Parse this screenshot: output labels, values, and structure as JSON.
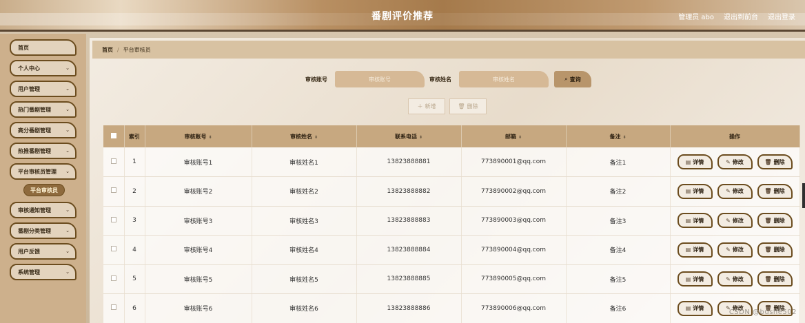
{
  "header": {
    "title": "番剧评价推荐",
    "user": "管理员 abo",
    "back_front": "退出到前台",
    "logout": "退出登录"
  },
  "sidebar": {
    "items": [
      {
        "label": "首页",
        "chevron": false
      },
      {
        "label": "个人中心",
        "chevron": true
      },
      {
        "label": "用户管理",
        "chevron": true
      },
      {
        "label": "热门番剧管理",
        "chevron": true
      },
      {
        "label": "高分番剧管理",
        "chevron": true
      },
      {
        "label": "热推番剧管理",
        "chevron": true
      },
      {
        "label": "平台审核员管理",
        "chevron": true
      },
      {
        "label": "审核通知管理",
        "chevron": true
      },
      {
        "label": "番剧分类管理",
        "chevron": true
      },
      {
        "label": "用户反馈",
        "chevron": true
      },
      {
        "label": "系统管理",
        "chevron": true
      }
    ],
    "active_sub": "平台审核员"
  },
  "breadcrumb": {
    "home": "首页",
    "sep": "/",
    "current": "平台审核员"
  },
  "search": {
    "account_label": "审核账号",
    "account_placeholder": "审核账号",
    "name_label": "审核姓名",
    "name_placeholder": "审核姓名",
    "query_label": "查询"
  },
  "actions": {
    "add": "新增",
    "delete": "删除"
  },
  "table": {
    "headers": {
      "index": "索引",
      "account": "审核账号",
      "name": "审核姓名",
      "phone": "联系电话",
      "email": "邮箱",
      "note": "备注",
      "ops": "操作"
    },
    "rows": [
      {
        "index": "1",
        "account": "审核账号1",
        "name": "审核姓名1",
        "phone": "13823888881",
        "email": "773890001@qq.com",
        "note": "备注1"
      },
      {
        "index": "2",
        "account": "审核账号2",
        "name": "审核姓名2",
        "phone": "13823888882",
        "email": "773890002@qq.com",
        "note": "备注2"
      },
      {
        "index": "3",
        "account": "审核账号3",
        "name": "审核姓名3",
        "phone": "13823888883",
        "email": "773890003@qq.com",
        "note": "备注3"
      },
      {
        "index": "4",
        "account": "审核账号4",
        "name": "审核姓名4",
        "phone": "13823888884",
        "email": "773890004@qq.com",
        "note": "备注4"
      },
      {
        "index": "5",
        "account": "审核账号5",
        "name": "审核姓名5",
        "phone": "13823888885",
        "email": "773890005@qq.com",
        "note": "备注5"
      },
      {
        "index": "6",
        "account": "审核账号6",
        "name": "审核姓名6",
        "phone": "13823888886",
        "email": "773890006@qq.com",
        "note": "备注6"
      }
    ],
    "op_labels": {
      "detail": "详情",
      "edit": "修改",
      "delete": "删除"
    }
  },
  "watermark": "CSDN @bushe502"
}
